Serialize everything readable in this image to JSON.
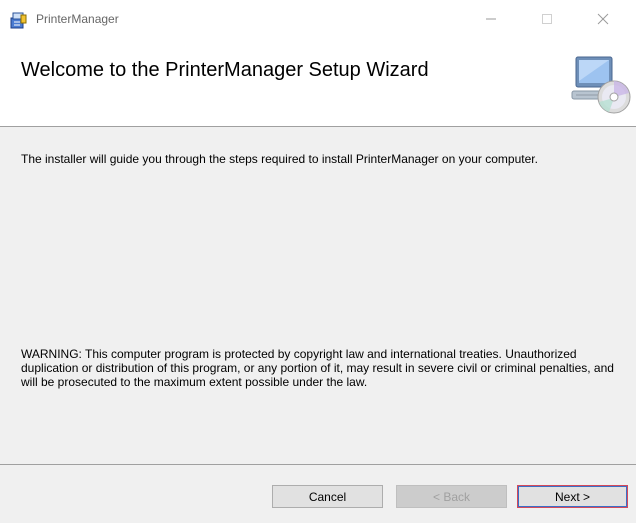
{
  "window": {
    "title": "PrinterManager",
    "icons": {
      "app": "installer-icon",
      "minimize": "minimize-icon",
      "maximize": "maximize-icon",
      "close": "close-icon"
    }
  },
  "header": {
    "title": "Welcome to the PrinterManager Setup Wizard",
    "graphic": "computer-cd-icon"
  },
  "body": {
    "intro": "The installer will guide you through the steps required to install PrinterManager on your computer.",
    "warning": "WARNING: This computer program is protected by copyright law and international treaties. Unauthorized duplication or distribution of this program, or any portion of it, may result in severe civil or criminal penalties, and will be prosecuted to the maximum extent possible under the law."
  },
  "footer": {
    "cancel_label": "Cancel",
    "back_label": "< Back",
    "next_label": "Next >"
  },
  "colors": {
    "content_bg": "#f0f0f0",
    "button_bg": "#e1e1e1",
    "default_button_focus": "#3d6ec7"
  }
}
